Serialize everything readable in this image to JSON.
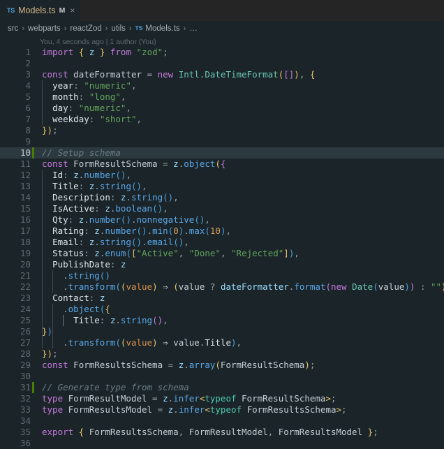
{
  "window": {
    "bg": "#1b2529",
    "accent_green": "#487e02"
  },
  "tab": {
    "file_icon_label": "TS",
    "title": "Models.ts",
    "dirty_indicator": "M",
    "close_glyph": "×"
  },
  "breadcrumb": {
    "separator": "›",
    "ts_icon_label": "TS",
    "items": [
      "src",
      "webparts",
      "reactZod",
      "utils",
      "Models.ts",
      "…"
    ]
  },
  "blame": {
    "text": "You, 4 seconds ago | 1 author (You)"
  },
  "editor": {
    "active_line": 10,
    "changed_lines": [
      10,
      31
    ],
    "lines": [
      {
        "n": 1,
        "text": "import { z } from \"zod\";"
      },
      {
        "n": 2,
        "text": ""
      },
      {
        "n": 3,
        "text": "const dateFormatter = new Intl.DateTimeFormat([], {"
      },
      {
        "n": 4,
        "text": "  year: \"numeric\","
      },
      {
        "n": 5,
        "text": "  month: \"long\","
      },
      {
        "n": 6,
        "text": "  day: \"numeric\","
      },
      {
        "n": 7,
        "text": "  weekday: \"short\","
      },
      {
        "n": 8,
        "text": "});"
      },
      {
        "n": 9,
        "text": ""
      },
      {
        "n": 10,
        "text": "// Setup schema"
      },
      {
        "n": 11,
        "text": "const FormResultSchema = z.object({"
      },
      {
        "n": 12,
        "text": "  Id: z.number(),"
      },
      {
        "n": 13,
        "text": "  Title: z.string(),"
      },
      {
        "n": 14,
        "text": "  Description: z.string(),"
      },
      {
        "n": 15,
        "text": "  IsActive: z.boolean(),"
      },
      {
        "n": 16,
        "text": "  Qty: z.number().nonnegative(),"
      },
      {
        "n": 17,
        "text": "  Rating: z.number().min(0).max(10),"
      },
      {
        "n": 18,
        "text": "  Email: z.string().email(),"
      },
      {
        "n": 19,
        "text": "  Status: z.enum([\"Active\", \"Done\", \"Rejected\"]),"
      },
      {
        "n": 20,
        "text": "  PublishDate: z"
      },
      {
        "n": 21,
        "text": "    .string()"
      },
      {
        "n": 22,
        "text": "    .transform((value) ⇒ (value ? dateFormatter.format(new Date(value)) : \"\")),"
      },
      {
        "n": 23,
        "text": "  Contact: z"
      },
      {
        "n": 24,
        "text": "    .object({"
      },
      {
        "n": 25,
        "text": "      Title: z.string(),"
      },
      {
        "n": 26,
        "text": "    })"
      },
      {
        "n": 27,
        "text": "    .transform((value) ⇒ value.Title),"
      },
      {
        "n": 28,
        "text": "});"
      },
      {
        "n": 29,
        "text": "const FormResultsSchema = z.array(FormResultSchema);"
      },
      {
        "n": 30,
        "text": ""
      },
      {
        "n": 31,
        "text": "// Generate type from schema"
      },
      {
        "n": 32,
        "text": "type FormResultModel = z.infer<typeof FormResultSchema>;"
      },
      {
        "n": 33,
        "text": "type FormResultsModel = z.infer<typeof FormResultsSchema>;"
      },
      {
        "n": 34,
        "text": ""
      },
      {
        "n": 35,
        "text": "export { FormResultsSchema, FormResultModel, FormResultsModel };"
      },
      {
        "n": 36,
        "text": ""
      }
    ],
    "tokens": {
      "1": [
        [
          "kw",
          "import"
        ],
        [
          "op",
          " "
        ],
        [
          "b1",
          "{"
        ],
        [
          "op",
          " "
        ],
        [
          "var",
          "z"
        ],
        [
          "op",
          " "
        ],
        [
          "b1",
          "}"
        ],
        [
          "op",
          " "
        ],
        [
          "kw",
          "from"
        ],
        [
          "op",
          " "
        ],
        [
          "str",
          "\"zod\""
        ],
        [
          "op",
          ";"
        ]
      ],
      "3": [
        [
          "kw",
          "const"
        ],
        [
          "op",
          " "
        ],
        [
          "ident",
          "dateFormatter"
        ],
        [
          "op",
          " = "
        ],
        [
          "kw",
          "new"
        ],
        [
          "op",
          " "
        ],
        [
          "cls",
          "Intl"
        ],
        [
          "op",
          "."
        ],
        [
          "cls",
          "DateTimeFormat"
        ],
        [
          "b1",
          "("
        ],
        [
          "b2",
          "["
        ],
        [
          "b2",
          "]"
        ],
        [
          "b1",
          ")"
        ],
        [
          "op",
          ", "
        ],
        [
          "b1",
          "{"
        ]
      ],
      "4": [
        [
          "op",
          "  "
        ],
        [
          "prop",
          "year"
        ],
        [
          "op",
          ": "
        ],
        [
          "str",
          "\"numeric\""
        ],
        [
          "op",
          ","
        ]
      ],
      "5": [
        [
          "op",
          "  "
        ],
        [
          "prop",
          "month"
        ],
        [
          "op",
          ": "
        ],
        [
          "str",
          "\"long\""
        ],
        [
          "op",
          ","
        ]
      ],
      "6": [
        [
          "op",
          "  "
        ],
        [
          "prop",
          "day"
        ],
        [
          "op",
          ": "
        ],
        [
          "str",
          "\"numeric\""
        ],
        [
          "op",
          ","
        ]
      ],
      "7": [
        [
          "op",
          "  "
        ],
        [
          "prop",
          "weekday"
        ],
        [
          "op",
          ": "
        ],
        [
          "str",
          "\"short\""
        ],
        [
          "op",
          ","
        ]
      ],
      "8": [
        [
          "b1",
          "}"
        ],
        [
          "b1",
          ")"
        ],
        [
          "op",
          ";"
        ]
      ],
      "10": [
        [
          "com",
          "// Setup schema"
        ]
      ],
      "11": [
        [
          "kw",
          "const"
        ],
        [
          "op",
          " "
        ],
        [
          "ident",
          "FormResultSchema"
        ],
        [
          "op",
          " = "
        ],
        [
          "var",
          "z"
        ],
        [
          "op",
          "."
        ],
        [
          "fn",
          "object"
        ],
        [
          "b1",
          "("
        ],
        [
          "b2",
          "{"
        ]
      ],
      "12": [
        [
          "op",
          "  "
        ],
        [
          "prop",
          "Id"
        ],
        [
          "op",
          ": "
        ],
        [
          "var",
          "z"
        ],
        [
          "op",
          "."
        ],
        [
          "fn",
          "number"
        ],
        [
          "b3",
          "("
        ],
        [
          "b3",
          ")"
        ],
        [
          "op",
          ","
        ]
      ],
      "13": [
        [
          "op",
          "  "
        ],
        [
          "prop",
          "Title"
        ],
        [
          "op",
          ": "
        ],
        [
          "var",
          "z"
        ],
        [
          "op",
          "."
        ],
        [
          "fn",
          "string"
        ],
        [
          "b3",
          "("
        ],
        [
          "b3",
          ")"
        ],
        [
          "op",
          ","
        ]
      ],
      "14": [
        [
          "op",
          "  "
        ],
        [
          "prop",
          "Description"
        ],
        [
          "op",
          ": "
        ],
        [
          "var",
          "z"
        ],
        [
          "op",
          "."
        ],
        [
          "fn",
          "string"
        ],
        [
          "b3",
          "("
        ],
        [
          "b3",
          ")"
        ],
        [
          "op",
          ","
        ]
      ],
      "15": [
        [
          "op",
          "  "
        ],
        [
          "prop",
          "IsActive"
        ],
        [
          "op",
          ": "
        ],
        [
          "var",
          "z"
        ],
        [
          "op",
          "."
        ],
        [
          "fn",
          "boolean"
        ],
        [
          "b3",
          "("
        ],
        [
          "b3",
          ")"
        ],
        [
          "op",
          ","
        ]
      ],
      "16": [
        [
          "op",
          "  "
        ],
        [
          "prop",
          "Qty"
        ],
        [
          "op",
          ": "
        ],
        [
          "var",
          "z"
        ],
        [
          "op",
          "."
        ],
        [
          "fn",
          "number"
        ],
        [
          "b3",
          "()"
        ],
        [
          "op",
          "."
        ],
        [
          "fn",
          "nonnegative"
        ],
        [
          "b3",
          "()"
        ],
        [
          "op",
          ","
        ]
      ],
      "17": [
        [
          "op",
          "  "
        ],
        [
          "prop",
          "Rating"
        ],
        [
          "op",
          ": "
        ],
        [
          "var",
          "z"
        ],
        [
          "op",
          "."
        ],
        [
          "fn",
          "number"
        ],
        [
          "b3",
          "()"
        ],
        [
          "op",
          "."
        ],
        [
          "fn",
          "min"
        ],
        [
          "b3",
          "("
        ],
        [
          "num",
          "0"
        ],
        [
          "b3",
          ")"
        ],
        [
          "op",
          "."
        ],
        [
          "fn",
          "max"
        ],
        [
          "b3",
          "("
        ],
        [
          "num",
          "10"
        ],
        [
          "b3",
          ")"
        ],
        [
          "op",
          ","
        ]
      ],
      "18": [
        [
          "op",
          "  "
        ],
        [
          "prop",
          "Email"
        ],
        [
          "op",
          ": "
        ],
        [
          "var",
          "z"
        ],
        [
          "op",
          "."
        ],
        [
          "fn",
          "string"
        ],
        [
          "b3",
          "()"
        ],
        [
          "op",
          "."
        ],
        [
          "fn",
          "email"
        ],
        [
          "b3",
          "()"
        ],
        [
          "op",
          ","
        ]
      ],
      "19": [
        [
          "op",
          "  "
        ],
        [
          "prop",
          "Status"
        ],
        [
          "op",
          ": "
        ],
        [
          "var",
          "z"
        ],
        [
          "op",
          "."
        ],
        [
          "fn",
          "enum"
        ],
        [
          "b3",
          "("
        ],
        [
          "b1",
          "["
        ],
        [
          "str",
          "\"Active\""
        ],
        [
          "op",
          ", "
        ],
        [
          "str",
          "\"Done\""
        ],
        [
          "op",
          ", "
        ],
        [
          "str",
          "\"Rejected\""
        ],
        [
          "b1",
          "]"
        ],
        [
          "b3",
          ")"
        ],
        [
          "op",
          ","
        ]
      ],
      "20": [
        [
          "op",
          "  "
        ],
        [
          "prop",
          "PublishDate"
        ],
        [
          "op",
          ": "
        ],
        [
          "var",
          "z"
        ]
      ],
      "21": [
        [
          "op",
          "    ."
        ],
        [
          "fn",
          "string"
        ],
        [
          "b3",
          "()"
        ]
      ],
      "22": [
        [
          "op",
          "    ."
        ],
        [
          "fn",
          "transform"
        ],
        [
          "b3",
          "("
        ],
        [
          "b1",
          "("
        ],
        [
          "param",
          "value"
        ],
        [
          "b1",
          ")"
        ],
        [
          "arrow",
          " ⇒ "
        ],
        [
          "b1",
          "("
        ],
        [
          "ident",
          "value"
        ],
        [
          "op",
          " ? "
        ],
        [
          "var",
          "dateFormatter"
        ],
        [
          "op",
          "."
        ],
        [
          "fn",
          "format"
        ],
        [
          "b2",
          "("
        ],
        [
          "kw",
          "new"
        ],
        [
          "op",
          " "
        ],
        [
          "cls",
          "Date"
        ],
        [
          "b3",
          "("
        ],
        [
          "ident",
          "value"
        ],
        [
          "b3",
          ")"
        ],
        [
          "b2",
          ")"
        ],
        [
          "op",
          " : "
        ],
        [
          "str",
          "\"\""
        ],
        [
          "b1",
          ")"
        ],
        [
          "b3",
          ")"
        ],
        [
          "op",
          ","
        ]
      ],
      "23": [
        [
          "op",
          "  "
        ],
        [
          "prop",
          "Contact"
        ],
        [
          "op",
          ": "
        ],
        [
          "var",
          "z"
        ]
      ],
      "24": [
        [
          "op",
          "    ."
        ],
        [
          "fn",
          "object"
        ],
        [
          "b3",
          "("
        ],
        [
          "b1",
          "{"
        ]
      ],
      "25": [
        [
          "op",
          "      "
        ],
        [
          "prop",
          "Title"
        ],
        [
          "op",
          ": "
        ],
        [
          "var",
          "z"
        ],
        [
          "op",
          "."
        ],
        [
          "fn",
          "string"
        ],
        [
          "b2",
          "()"
        ],
        [
          "op",
          ","
        ]
      ],
      "26": [
        [
          "b1",
          "}"
        ],
        [
          "b3",
          ")"
        ]
      ],
      "27": [
        [
          "op",
          "    ."
        ],
        [
          "fn",
          "transform"
        ],
        [
          "b3",
          "("
        ],
        [
          "b1",
          "("
        ],
        [
          "param",
          "value"
        ],
        [
          "b1",
          ")"
        ],
        [
          "arrow",
          " ⇒ "
        ],
        [
          "ident",
          "value"
        ],
        [
          "op",
          "."
        ],
        [
          "prop",
          "Title"
        ],
        [
          "b3",
          ")"
        ],
        [
          "op",
          ","
        ]
      ],
      "28": [
        [
          "b1",
          "}"
        ],
        [
          "b1",
          ")"
        ],
        [
          "op",
          ";"
        ]
      ],
      "29": [
        [
          "kw",
          "const"
        ],
        [
          "op",
          " "
        ],
        [
          "ident",
          "FormResultsSchema"
        ],
        [
          "op",
          " = "
        ],
        [
          "var",
          "z"
        ],
        [
          "op",
          "."
        ],
        [
          "fn",
          "array"
        ],
        [
          "b1",
          "("
        ],
        [
          "ident",
          "FormResultSchema"
        ],
        [
          "b1",
          ")"
        ],
        [
          "op",
          ";"
        ]
      ],
      "31": [
        [
          "com",
          "// Generate type from schema"
        ]
      ],
      "32": [
        [
          "kw",
          "type"
        ],
        [
          "op",
          " "
        ],
        [
          "ident",
          "FormResultModel"
        ],
        [
          "op",
          " = "
        ],
        [
          "var",
          "z"
        ],
        [
          "op",
          "."
        ],
        [
          "fn",
          "infer"
        ],
        [
          "b1",
          "<"
        ],
        [
          "kw2",
          "typeof"
        ],
        [
          "op",
          " "
        ],
        [
          "ident",
          "FormResultSchema"
        ],
        [
          "b1",
          ">"
        ],
        [
          "op",
          ";"
        ]
      ],
      "33": [
        [
          "kw",
          "type"
        ],
        [
          "op",
          " "
        ],
        [
          "ident",
          "FormResultsModel"
        ],
        [
          "op",
          " = "
        ],
        [
          "var",
          "z"
        ],
        [
          "op",
          "."
        ],
        [
          "fn",
          "infer"
        ],
        [
          "b1",
          "<"
        ],
        [
          "kw2",
          "typeof"
        ],
        [
          "op",
          " "
        ],
        [
          "ident",
          "FormResultsSchema"
        ],
        [
          "b1",
          ">"
        ],
        [
          "op",
          ";"
        ]
      ],
      "35": [
        [
          "kw",
          "export"
        ],
        [
          "op",
          " "
        ],
        [
          "b1",
          "{"
        ],
        [
          "op",
          " "
        ],
        [
          "ident",
          "FormResultsSchema"
        ],
        [
          "op",
          ", "
        ],
        [
          "ident",
          "FormResultModel"
        ],
        [
          "op",
          ", "
        ],
        [
          "ident",
          "FormResultsModel"
        ],
        [
          "op",
          " "
        ],
        [
          "b1",
          "}"
        ],
        [
          "op",
          ";"
        ]
      ]
    },
    "indent_guides": {
      "4": [
        1
      ],
      "5": [
        1
      ],
      "6": [
        1
      ],
      "7": [
        1
      ],
      "12": [
        1
      ],
      "13": [
        1
      ],
      "14": [
        1
      ],
      "15": [
        1
      ],
      "16": [
        1
      ],
      "17": [
        1
      ],
      "18": [
        1
      ],
      "19": [
        1
      ],
      "20": [
        1
      ],
      "21": [
        1,
        2
      ],
      "22": [
        1,
        2
      ],
      "23": [
        1
      ],
      "24": [
        1,
        2
      ],
      "25": [
        1,
        2,
        3
      ],
      "26": [
        1,
        2
      ],
      "27": [
        1,
        2
      ]
    }
  }
}
